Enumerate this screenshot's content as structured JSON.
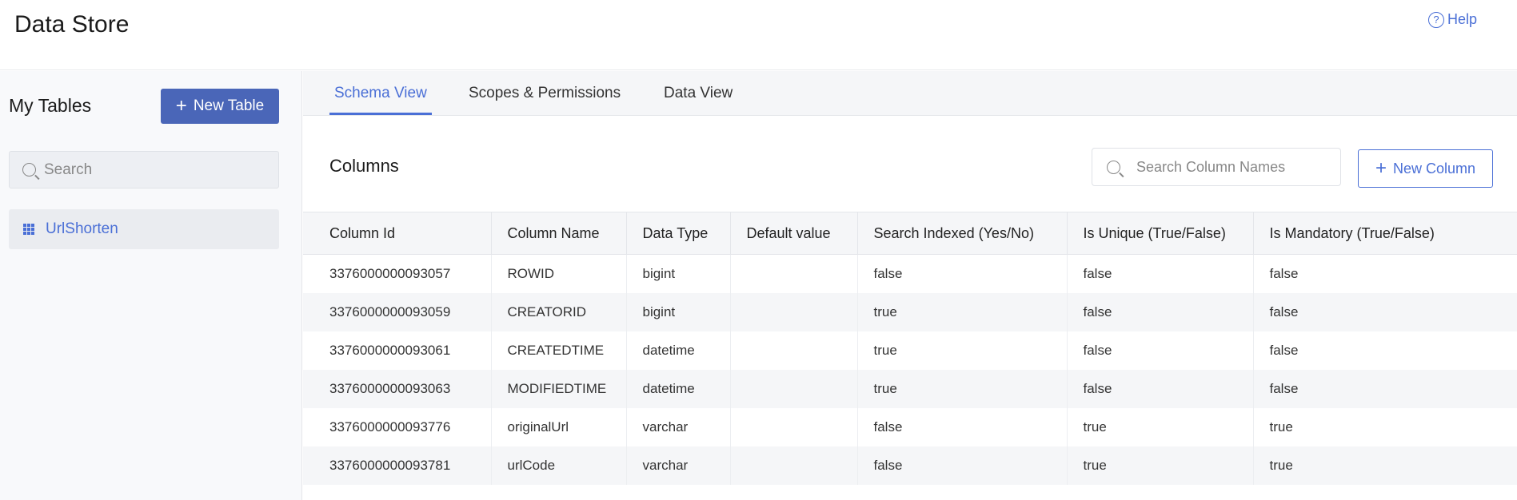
{
  "header": {
    "title": "Data Store",
    "help_label": "Help"
  },
  "sidebar": {
    "title": "My Tables",
    "new_table_label": "New Table",
    "search_placeholder": "Search",
    "items": [
      {
        "label": "UrlShorten"
      }
    ]
  },
  "tabs": [
    {
      "label": "Schema View",
      "active": true
    },
    {
      "label": "Scopes & Permissions"
    },
    {
      "label": "Data View"
    }
  ],
  "main": {
    "title": "Columns",
    "search_placeholder": "Search Column Names",
    "new_column_label": "New Column"
  },
  "table": {
    "headers": [
      "Column Id",
      "Column Name",
      "Data Type",
      "Default value",
      "Search Indexed (Yes/No)",
      "Is Unique (True/False)",
      "Is Mandatory (True/False)"
    ],
    "rows": [
      [
        "3376000000093057",
        "ROWID",
        "bigint",
        "",
        "false",
        "false",
        "false"
      ],
      [
        "3376000000093059",
        "CREATORID",
        "bigint",
        "",
        "true",
        "false",
        "false"
      ],
      [
        "3376000000093061",
        "CREATEDTIME",
        "datetime",
        "",
        "true",
        "false",
        "false"
      ],
      [
        "3376000000093063",
        "MODIFIEDTIME",
        "datetime",
        "",
        "true",
        "false",
        "false"
      ],
      [
        "3376000000093776",
        "originalUrl",
        "varchar",
        "",
        "false",
        "true",
        "true"
      ],
      [
        "3376000000093781",
        "urlCode",
        "varchar",
        "",
        "false",
        "true",
        "true"
      ]
    ]
  }
}
